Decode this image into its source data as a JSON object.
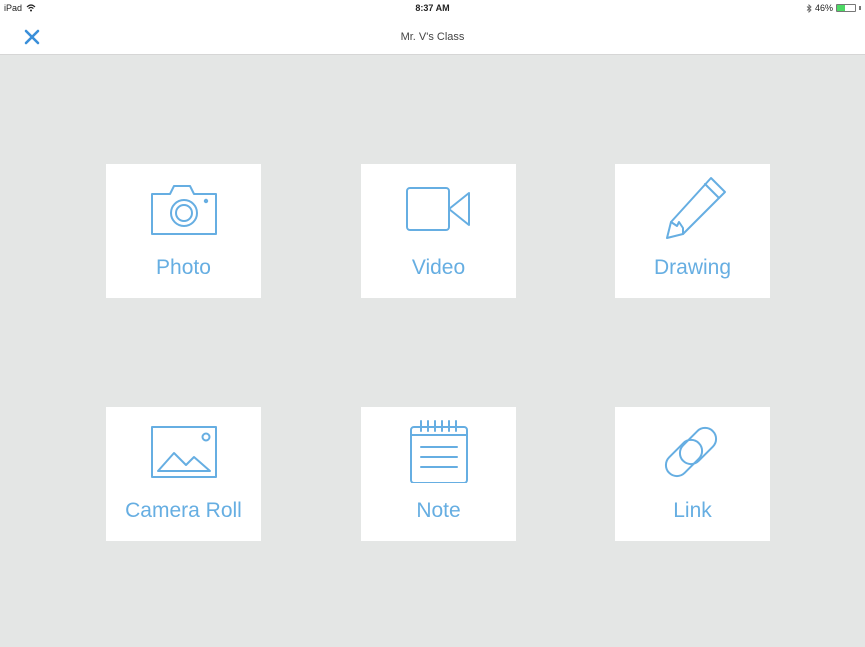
{
  "status_bar": {
    "device": "iPad",
    "time": "8:37 AM",
    "battery_text": "46%",
    "battery_level": 0.46,
    "wifi_icon": "wifi-icon",
    "bluetooth_icon": "bluetooth-icon"
  },
  "nav": {
    "title": "Mr. V's Class",
    "close_icon": "close-icon"
  },
  "options": {
    "photo": {
      "label": "Photo",
      "icon": "camera-icon"
    },
    "video": {
      "label": "Video",
      "icon": "video-camera-icon"
    },
    "drawing": {
      "label": "Drawing",
      "icon": "pencil-icon"
    },
    "camera_roll": {
      "label": "Camera Roll",
      "icon": "image-icon"
    },
    "note": {
      "label": "Note",
      "icon": "notepad-icon"
    },
    "link": {
      "label": "Link",
      "icon": "link-icon"
    }
  },
  "colors": {
    "accent": "#66aee2",
    "background": "#e4e6e5",
    "close": "#3a8fd9"
  }
}
